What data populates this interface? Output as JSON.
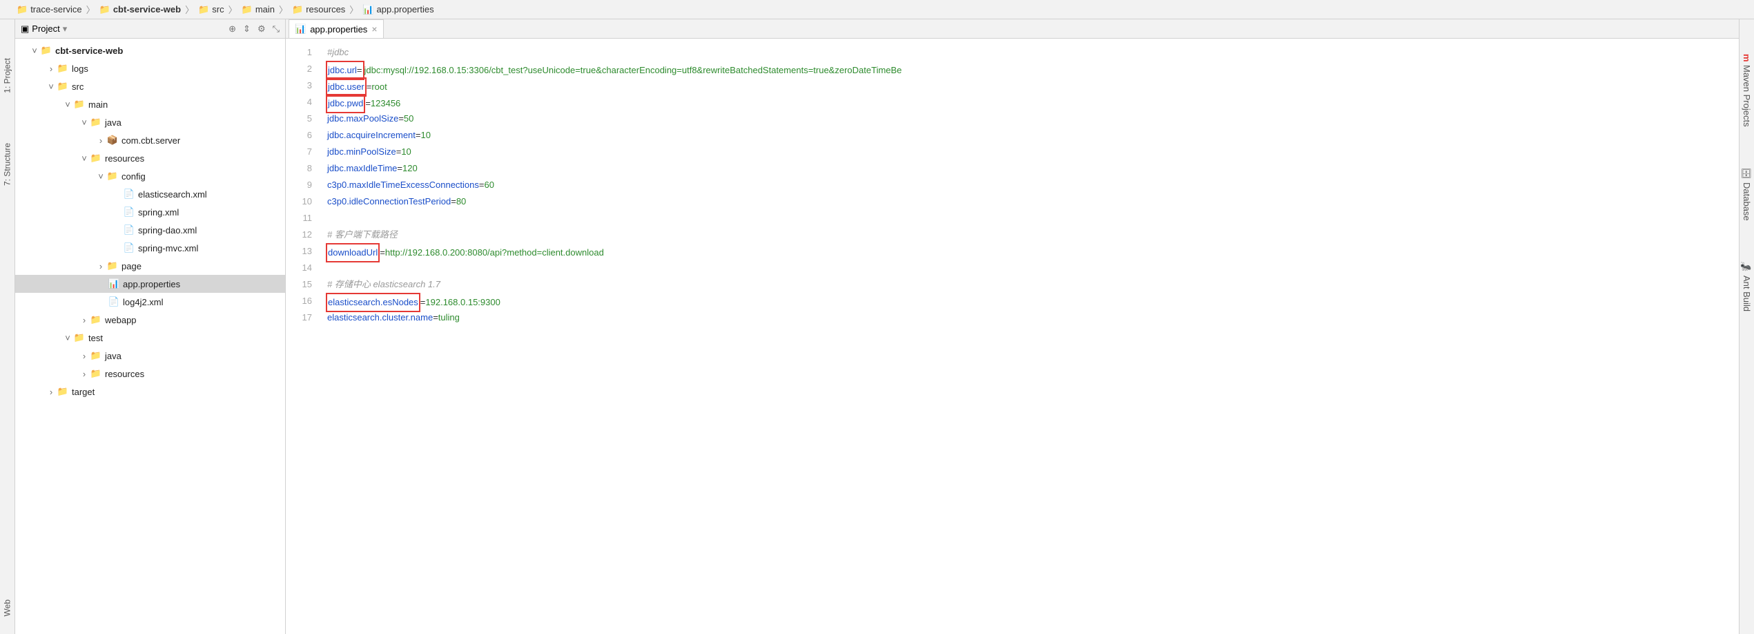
{
  "breadcrumbs": [
    "trace-service",
    "cbt-service-web",
    "src",
    "main",
    "resources",
    "app.properties"
  ],
  "left_tabs": {
    "project": "1: Project",
    "structure": "7: Structure",
    "web": "Web"
  },
  "right_tabs": {
    "maven": "Maven Projects",
    "database": "Database",
    "ant": "Ant Build"
  },
  "project_panel": {
    "title": "Project"
  },
  "tree": {
    "root": "cbt-service-web",
    "logs": "logs",
    "src": "src",
    "main": "main",
    "java": "java",
    "pkg": "com.cbt.server",
    "resources": "resources",
    "config": "config",
    "f_es": "elasticsearch.xml",
    "f_spring": "spring.xml",
    "f_springdao": "spring-dao.xml",
    "f_springmvc": "spring-mvc.xml",
    "page": "page",
    "app": "app.properties",
    "log4j": "log4j2.xml",
    "webapp": "webapp",
    "test": "test",
    "tjava": "java",
    "tres": "resources",
    "target": "target"
  },
  "editor": {
    "tab": "app.properties"
  },
  "code": {
    "l1": "#jdbc",
    "l2k": "jdbc.url",
    "l2v": "jdbc:mysql://192.168.0.15:3306/cbt_test?useUnicode=true&characterEncoding=utf8&rewriteBatchedStatements=true&zeroDateTimeBe",
    "l3k": "jdbc.user",
    "l3v": "root",
    "l4k": "jdbc.pwd",
    "l4v": "123456",
    "l5k": "jdbc.maxPoolSize",
    "l5v": "50",
    "l6k": "jdbc.acquireIncrement",
    "l6v": "10",
    "l7k": "jdbc.minPoolSize",
    "l7v": "10",
    "l8k": "jdbc.maxIdleTime",
    "l8v": "120",
    "l9k": "c3p0.maxIdleTimeExcessConnections",
    "l9v": "60",
    "l10k": "c3p0.idleConnectionTestPeriod",
    "l10v": "80",
    "l12": "# 客户端下载路径",
    "l13k": "downloadUrl",
    "l13v": "http://192.168.0.200:8080/api?method=client.download",
    "l15": "# 存储中心 elasticsearch 1.7",
    "l16k": "elasticsearch.esNodes",
    "l16v": "192.168.0.15:9300",
    "l17k": "elasticsearch.cluster.name",
    "l17v": "tuling"
  },
  "line_numbers": [
    "1",
    "2",
    "3",
    "4",
    "5",
    "6",
    "7",
    "8",
    "9",
    "10",
    "11",
    "12",
    "13",
    "14",
    "15",
    "16",
    "17"
  ]
}
